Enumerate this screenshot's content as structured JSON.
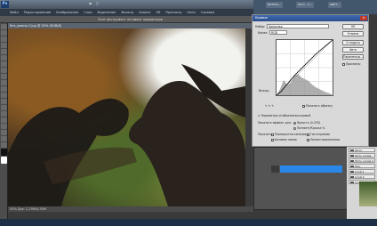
{
  "app": {
    "logo": "Ps",
    "doc_title": "Без_имени-1.jpg @ 50% (RGB/8)"
  },
  "menubar": [
    "Файл",
    "Редактирование",
    "Изображение",
    "Слои",
    "Выделение",
    "Фильтр",
    "Анализ",
    "3D",
    "Просмотр",
    "Окно",
    "Справка"
  ],
  "optbar": {
    "text": "Этот инструмент не имеет параметров"
  },
  "top_right_tabs": [
    "BOTSTA...",
    "Фото - C...",
    "ЦВЕТ..."
  ],
  "curves": {
    "title": "Кривые",
    "preset_label": "Набор:",
    "preset_value": "Заказная",
    "channel_label": "Канал:",
    "channel_value": "RGB",
    "output_label": "Выход:",
    "buttons": [
      "OK",
      "Отмена",
      "Сгладить",
      "Авто",
      "Параметры..."
    ],
    "preview_label": "Просмотр",
    "show_clipping": "Показать обрезку",
    "display_options": "Параметры отображения кривой",
    "show_amount_label": "Показать эффект для:",
    "light_option": "Яркость (0-255)",
    "pigment_option": "Пигмент/Краска %",
    "show_label": "Показать:",
    "channel_overlays": "Перекрытия каналов",
    "baseline": "Гистограмма",
    "intersection": "Базовая линия",
    "grid_line": "Линия пересечения"
  },
  "layers": [
    "Фото",
    "Фото копия",
    "Фото копия 2",
    "Фон",
    "Слой 1",
    "Слой 2",
    "Слой 3",
    "Слой 4",
    "Слой 5",
    "Слой 6",
    "Слой 7"
  ],
  "statusbar": {
    "text": "50%  Док: 2,25M/4,50M"
  }
}
